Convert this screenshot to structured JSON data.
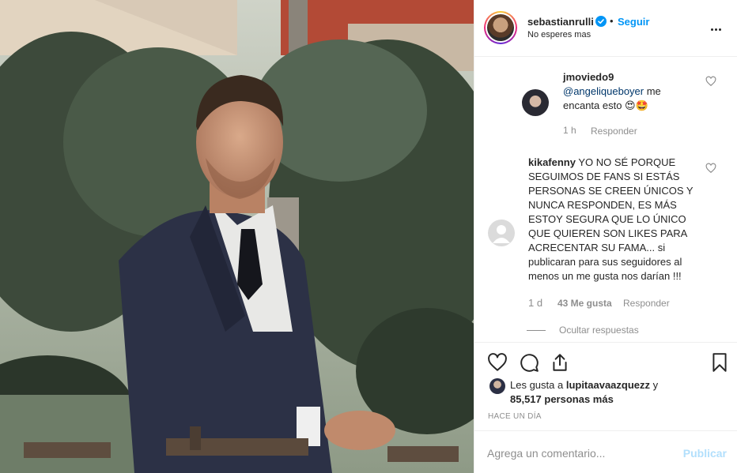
{
  "post": {
    "username": "sebastianrulli",
    "follow_label": "Seguir",
    "separator": "•",
    "location": "No esperes mas"
  },
  "comments": [
    {
      "username": "jmoviedo9",
      "mention": "@angeliqueboyer",
      "text_line1": " me",
      "text_line2": "encanta esto 😍🤩",
      "time": "1 h",
      "reply_label": "Responder"
    },
    {
      "username": "kikafenny",
      "text_lines": [
        " YO NO SÉ PORQUE",
        "SEGUIMOS DE FANS SI ESTÁS",
        "PERSONAS SE CREEN ÚNICOS Y",
        "NUNCA RESPONDEN, ES MÁS",
        "ESTOY SEGURA QUE LO ÚNICO",
        "QUE QUIEREN SON LIKES PARA",
        "ACRECENTAR SU FAMA... si",
        "publicaran para sus seguidores al",
        "menos un me gusta nos darían !!!"
      ],
      "time": "1 d",
      "likes": "43 Me gusta",
      "reply_label": "Responder",
      "hide_replies_label": "Ocultar respuestas"
    }
  ],
  "likes": {
    "prefix": "Les gusta a ",
    "user": "lupitaavaazquezz",
    "conj": " y",
    "count": "85,517",
    "suffix": " personas más"
  },
  "time_ago": "HACE UN DÍA",
  "add_comment": {
    "placeholder": "Agrega un comentario...",
    "post_label": "Publicar"
  },
  "colors": {
    "link_blue": "#0095f6",
    "muted": "#8e8e8e",
    "text": "#262626",
    "post_disabled": "#b2dffc"
  }
}
